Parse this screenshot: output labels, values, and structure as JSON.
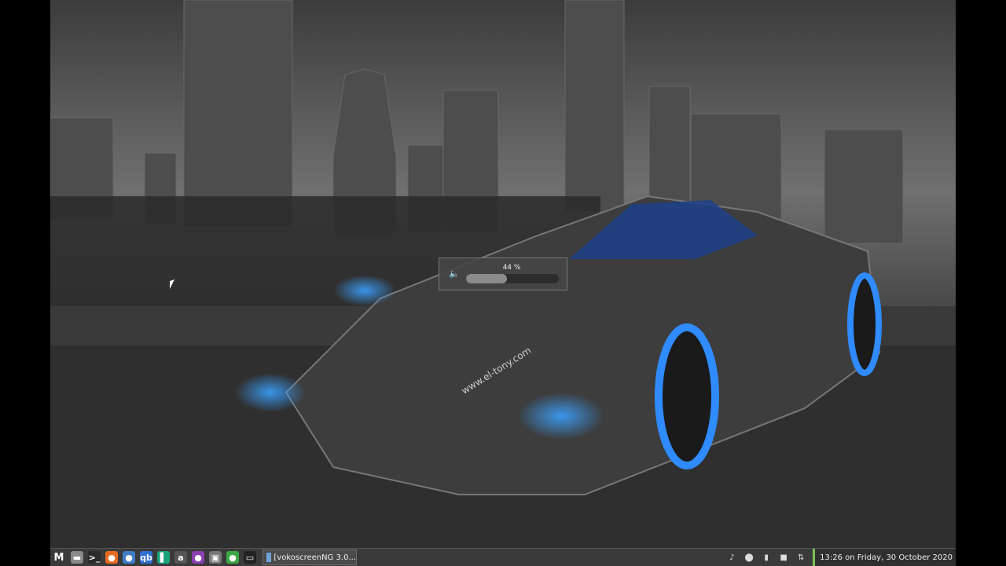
{
  "volume_osd": {
    "percent_label": "44 %",
    "level": 0.44,
    "icon": "speaker-icon"
  },
  "wallpaper": {
    "watermark": "www.el-tony.com"
  },
  "taskbar": {
    "launchers": [
      {
        "name": "menu-icon",
        "glyph": "M",
        "color": "#3a3a3a"
      },
      {
        "name": "files-icon",
        "glyph": "▬",
        "color": "#8a8a8a"
      },
      {
        "name": "terminal-icon",
        "glyph": ">_",
        "color": "#2b2b2b"
      },
      {
        "name": "firefox-icon",
        "glyph": "●",
        "color": "#e66b1f"
      },
      {
        "name": "thunderbird-icon",
        "glyph": "●",
        "color": "#3f7dc9"
      },
      {
        "name": "qbittorrent-icon",
        "glyph": "qb",
        "color": "#2f6fd1"
      },
      {
        "name": "editor-icon",
        "glyph": "▌",
        "color": "#1aa37a"
      },
      {
        "name": "amazon-icon",
        "glyph": "a",
        "color": "#555"
      },
      {
        "name": "media-player-icon",
        "glyph": "●",
        "color": "#8b3fb0"
      },
      {
        "name": "image-viewer-icon",
        "glyph": "▣",
        "color": "#777"
      },
      {
        "name": "updater-icon",
        "glyph": "●",
        "color": "#3aa845"
      },
      {
        "name": "show-desktop-icon",
        "glyph": "▭",
        "color": "#222"
      }
    ],
    "window_button_label": "[vokoscreenNG 3.0...",
    "tray": [
      {
        "name": "volume-tray-icon",
        "glyph": "♪"
      },
      {
        "name": "update-tray-icon",
        "glyph": "⬤"
      },
      {
        "name": "clipboard-tray-icon",
        "glyph": "▮"
      },
      {
        "name": "record-tray-icon",
        "glyph": "■"
      },
      {
        "name": "network-tray-icon",
        "glyph": "⇅"
      }
    ],
    "clock": "13:26 on Friday, 30 October 2020"
  }
}
